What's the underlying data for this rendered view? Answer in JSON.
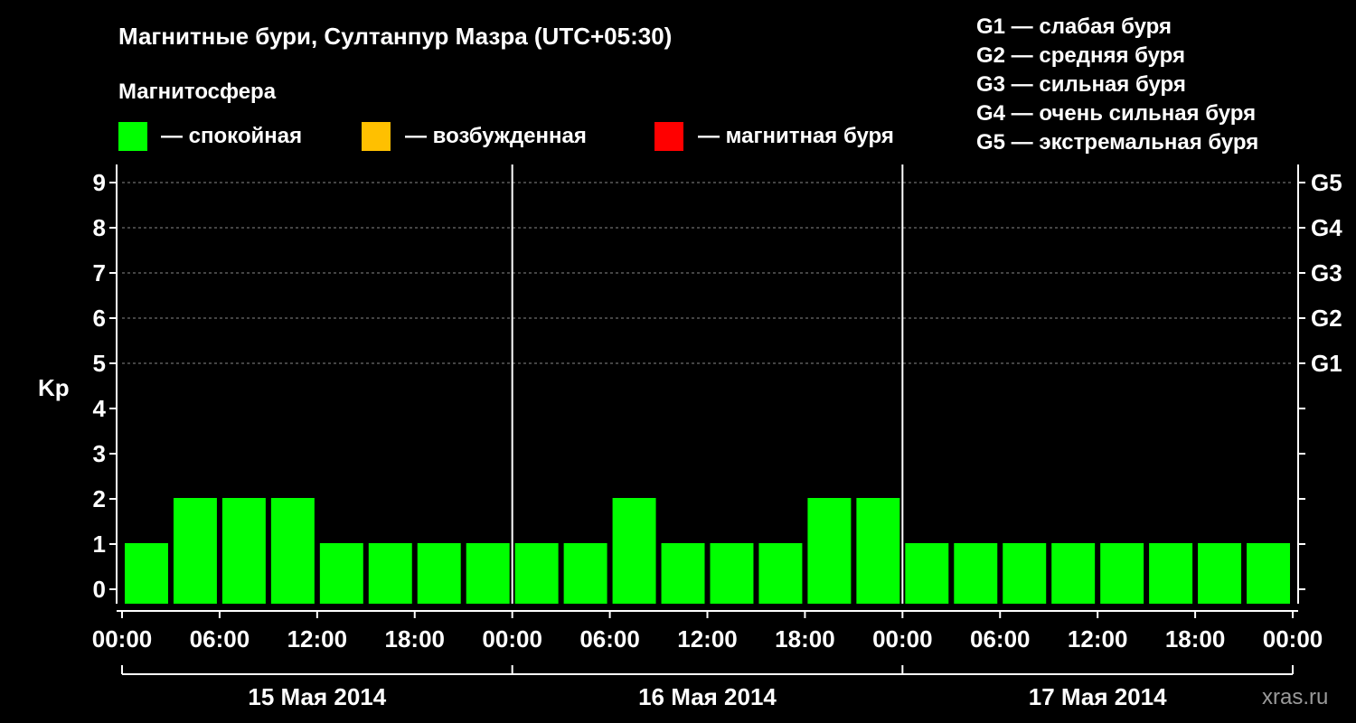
{
  "header": {
    "title": "Магнитные бури, Султанпур Мазра (UTC+05:30)",
    "subtitle": "Магнитосфера"
  },
  "legend": [
    {
      "label": "— спокойная",
      "color": "#00ff00"
    },
    {
      "label": "— возбужденная",
      "color": "#ffc000"
    },
    {
      "label": "— магнитная буря",
      "color": "#ff0000"
    }
  ],
  "g_scale": [
    "G1 — слабая буря",
    "G2 — средняя буря",
    "G3 — сильная буря",
    "G4 — очень сильная буря",
    "G5 — экстремальная буря"
  ],
  "watermark": "xras.ru",
  "chart_data": {
    "type": "bar",
    "ylabel": "Kp",
    "ylim": [
      0,
      9
    ],
    "yticks": [
      "0",
      "1",
      "2",
      "3",
      "4",
      "5",
      "6",
      "7",
      "8",
      "9"
    ],
    "right_ticks": [
      {
        "kp": 5,
        "label": "G1"
      },
      {
        "kp": 6,
        "label": "G2"
      },
      {
        "kp": 7,
        "label": "G3"
      },
      {
        "kp": 8,
        "label": "G4"
      },
      {
        "kp": 9,
        "label": "G5"
      }
    ],
    "grid": "dashed horizontal at Kp 5–9",
    "xticks": [
      "00:00",
      "06:00",
      "12:00",
      "18:00",
      "00:00",
      "06:00",
      "12:00",
      "18:00",
      "00:00",
      "06:00",
      "12:00",
      "18:00",
      "00:00"
    ],
    "days": [
      "15 Мая 2014",
      "16 Мая 2014",
      "17 Мая 2014"
    ],
    "interval_hours": 3,
    "values": [
      1,
      2,
      2,
      2,
      1,
      1,
      1,
      1,
      1,
      1,
      2,
      1,
      1,
      1,
      2,
      2,
      1,
      1,
      1,
      1,
      1,
      1,
      1,
      1
    ],
    "bar_color": "#00ff00"
  }
}
